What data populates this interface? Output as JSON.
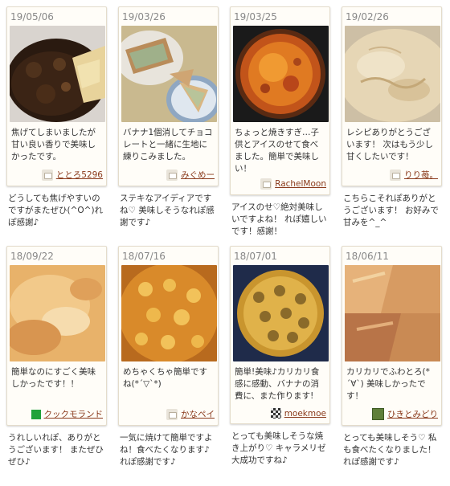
{
  "cards": [
    {
      "date": "19/05/06",
      "photo": "dark-burnt-cake-photo",
      "description": "焦げてしまいましたが甘い良い香りで美味しかったです。",
      "user": "ととろ5296",
      "user_icon": "default-user-icon",
      "reply": "どうしても焦げやすいのですがまたぜひ(^O^)れぽ感謝♪"
    },
    {
      "date": "19/03/26",
      "photo": "sliced-cake-plates-photo",
      "description": "バナナ1個消してチョコレートと一緒に生地に練りこみました。",
      "user": "みぐめー",
      "user_icon": "default-user-icon",
      "reply": "ステキなアイディアですね♡ 美味しそうなれぽ感謝です♪"
    },
    {
      "date": "19/03/25",
      "photo": "caramelized-pan-cake-photo",
      "description": "ちょっと焼きすぎ…子供とアイスのせて食べました。簡単で美味しい！",
      "user": "RachelMoon",
      "user_icon": "default-user-icon",
      "reply": "アイスのせ♡絶対美味しいですよね！ れぽ嬉しいです！感謝！"
    },
    {
      "date": "19/02/26",
      "photo": "pale-cake-closeup-photo",
      "description": "レシピありがとうございます！ 次はもう少し甘くしたいです！",
      "user": "りり苺。",
      "user_icon": "default-user-icon",
      "reply": "こちらこそれぽありがとうございます！ お好みで甘みを^_^"
    },
    {
      "date": "18/09/22",
      "photo": "golden-cake-closeup-photo",
      "description": "簡単なのにすごく美味しかったです！！",
      "user": "クックモランド",
      "user_icon": "green-square-icon",
      "reply": "うれしいれぽ、ありがとうございます！ またぜひぜひ♪"
    },
    {
      "date": "18/07/16",
      "photo": "banana-topped-cake-photo",
      "description": "めちゃくちゃ簡単ですね(*´▽`*)",
      "user": "かなペイ",
      "user_icon": "default-user-icon",
      "reply": "一気に焼けて簡単ですよね！食べたくなります♪れぽ感謝です♪"
    },
    {
      "date": "18/07/01",
      "photo": "banana-slices-pan-cake-photo",
      "description": "簡単!美味♪カリカリ食感に感動、バナナの消費に、また作ります!",
      "user": "moekmoe",
      "user_icon": "pattern-avatar-icon",
      "reply": "とっても美味しそうな焼き上がり♡ キャラメリゼ大成功ですね♪"
    },
    {
      "date": "18/06/11",
      "photo": "sliced-cake-tray-photo",
      "description": "カリカリでふわとろ(*´∀`) 美味しかったです！",
      "user": "ひきとみどり",
      "user_icon": "photo-avatar-icon",
      "reply": "とっても美味しそう♡ 私も食べたくなりました！ れぽ感謝です♪"
    }
  ]
}
